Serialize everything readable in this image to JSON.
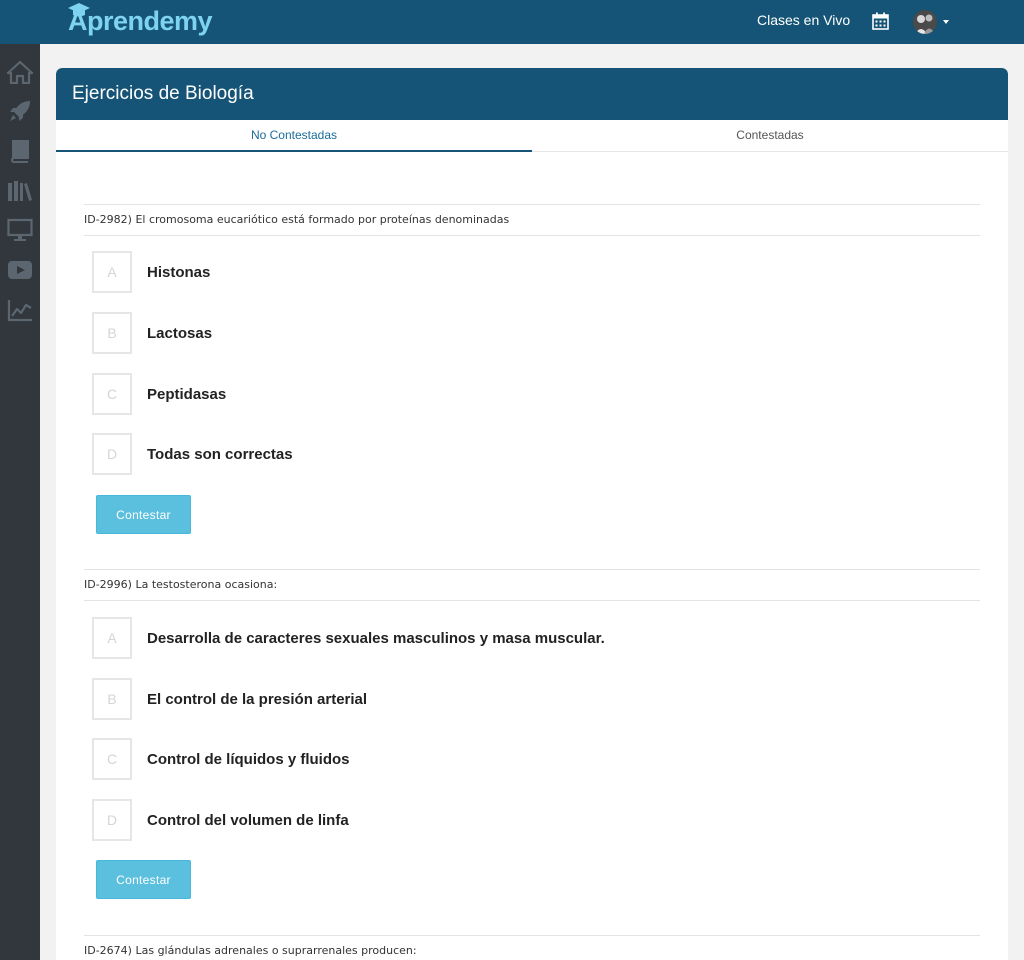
{
  "header": {
    "logo_text": "Aprendemy",
    "live_classes": "Clases en Vivo"
  },
  "sidebar": {
    "items": [
      {
        "icon": "home-icon"
      },
      {
        "icon": "rocket-icon"
      },
      {
        "icon": "book-icon"
      },
      {
        "icon": "library-icon"
      },
      {
        "icon": "monitor-icon"
      },
      {
        "icon": "video-icon"
      },
      {
        "icon": "chart-icon"
      }
    ]
  },
  "page": {
    "title": "Ejercicios de Biología",
    "tabs": [
      {
        "label": "No Contestadas",
        "active": true
      },
      {
        "label": "Contestadas",
        "active": false
      }
    ]
  },
  "questions": [
    {
      "text": "ID-2982) El cromosoma eucariótico está formado por proteínas denominadas",
      "options": [
        {
          "letter": "A",
          "text": "Histonas"
        },
        {
          "letter": "B",
          "text": "Lactosas"
        },
        {
          "letter": "C",
          "text": "Peptidasas"
        },
        {
          "letter": "D",
          "text": "Todas son correctas"
        }
      ],
      "button": "Contestar"
    },
    {
      "text": "ID-2996) La testosterona ocasiona:",
      "options": [
        {
          "letter": "A",
          "text": "Desarrolla de caracteres sexuales masculinos y masa muscular."
        },
        {
          "letter": "B",
          "text": "El control de la presión arterial"
        },
        {
          "letter": "C",
          "text": "Control de líquidos y fluidos"
        },
        {
          "letter": "D",
          "text": "Control del volumen de linfa"
        }
      ],
      "button": "Contestar"
    },
    {
      "text": "ID-2674) Las glándulas adrenales o suprarrenales producen:"
    }
  ],
  "colors": {
    "header_bg": "#155476",
    "sidebar_bg": "#31373c",
    "button_bg": "#5bc0de",
    "logo": "#7dd3f0"
  }
}
